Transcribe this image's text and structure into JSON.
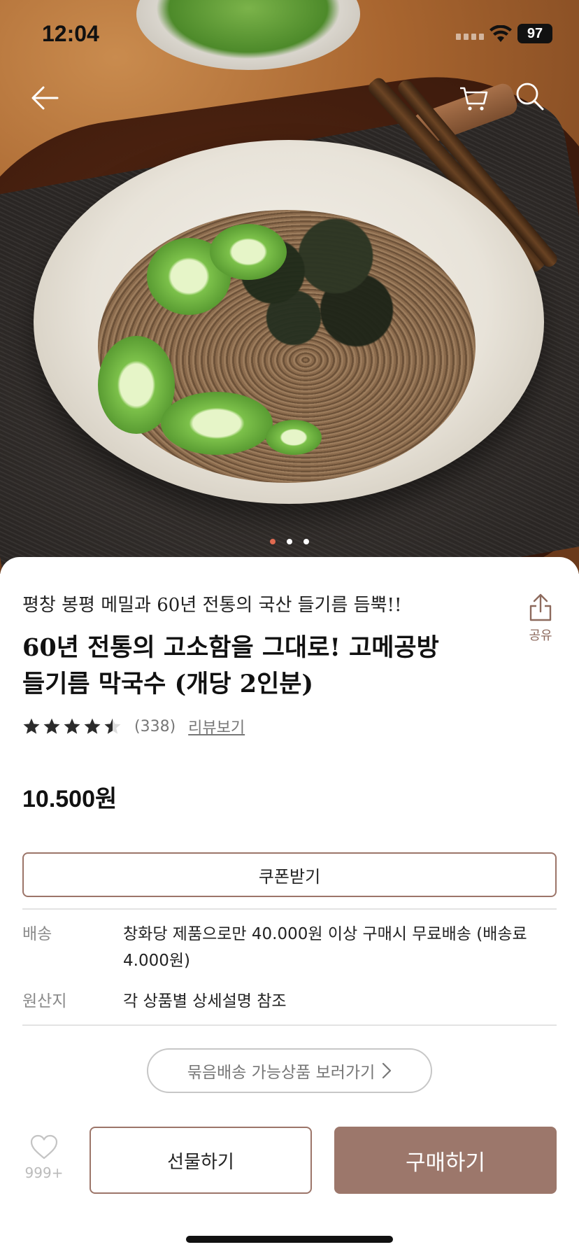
{
  "status_bar": {
    "time": "12:04",
    "battery": "97"
  },
  "nav": {
    "icons": [
      "back-arrow-icon",
      "cart-icon",
      "search-icon"
    ]
  },
  "carousel": {
    "count": 3,
    "active_index": 0,
    "active_color": "#e06a50"
  },
  "product": {
    "subtitle": "평창 봉평 메밀과 60년 전통의 국산 들기름 듬뿍!!",
    "title": "60년 전통의 고소함을 그대로! 고메공방 들기름 막국수 (개당 2인분)",
    "rating": 4.5,
    "review_count": "(338)",
    "review_link": "리뷰보기",
    "price": "10.500원"
  },
  "share": {
    "label": "공유"
  },
  "coupon": {
    "label": "쿠폰받기"
  },
  "info": [
    {
      "key": "배송",
      "value": "창화당 제품으로만 40.000원 이상 구매시 무료배송 (배송료 4.000원)"
    },
    {
      "key": "원산지",
      "value": "각 상품별 상세설명 참조"
    }
  ],
  "bundle": {
    "label": "묶음배송 가능상품 보러가기"
  },
  "bottom_bar": {
    "like_count": "999+",
    "gift_label": "선물하기",
    "buy_label": "구매하기"
  },
  "colors": {
    "accent": "#9c776b",
    "border_accent": "#9c7569",
    "share_text": "#8d6a5d"
  }
}
